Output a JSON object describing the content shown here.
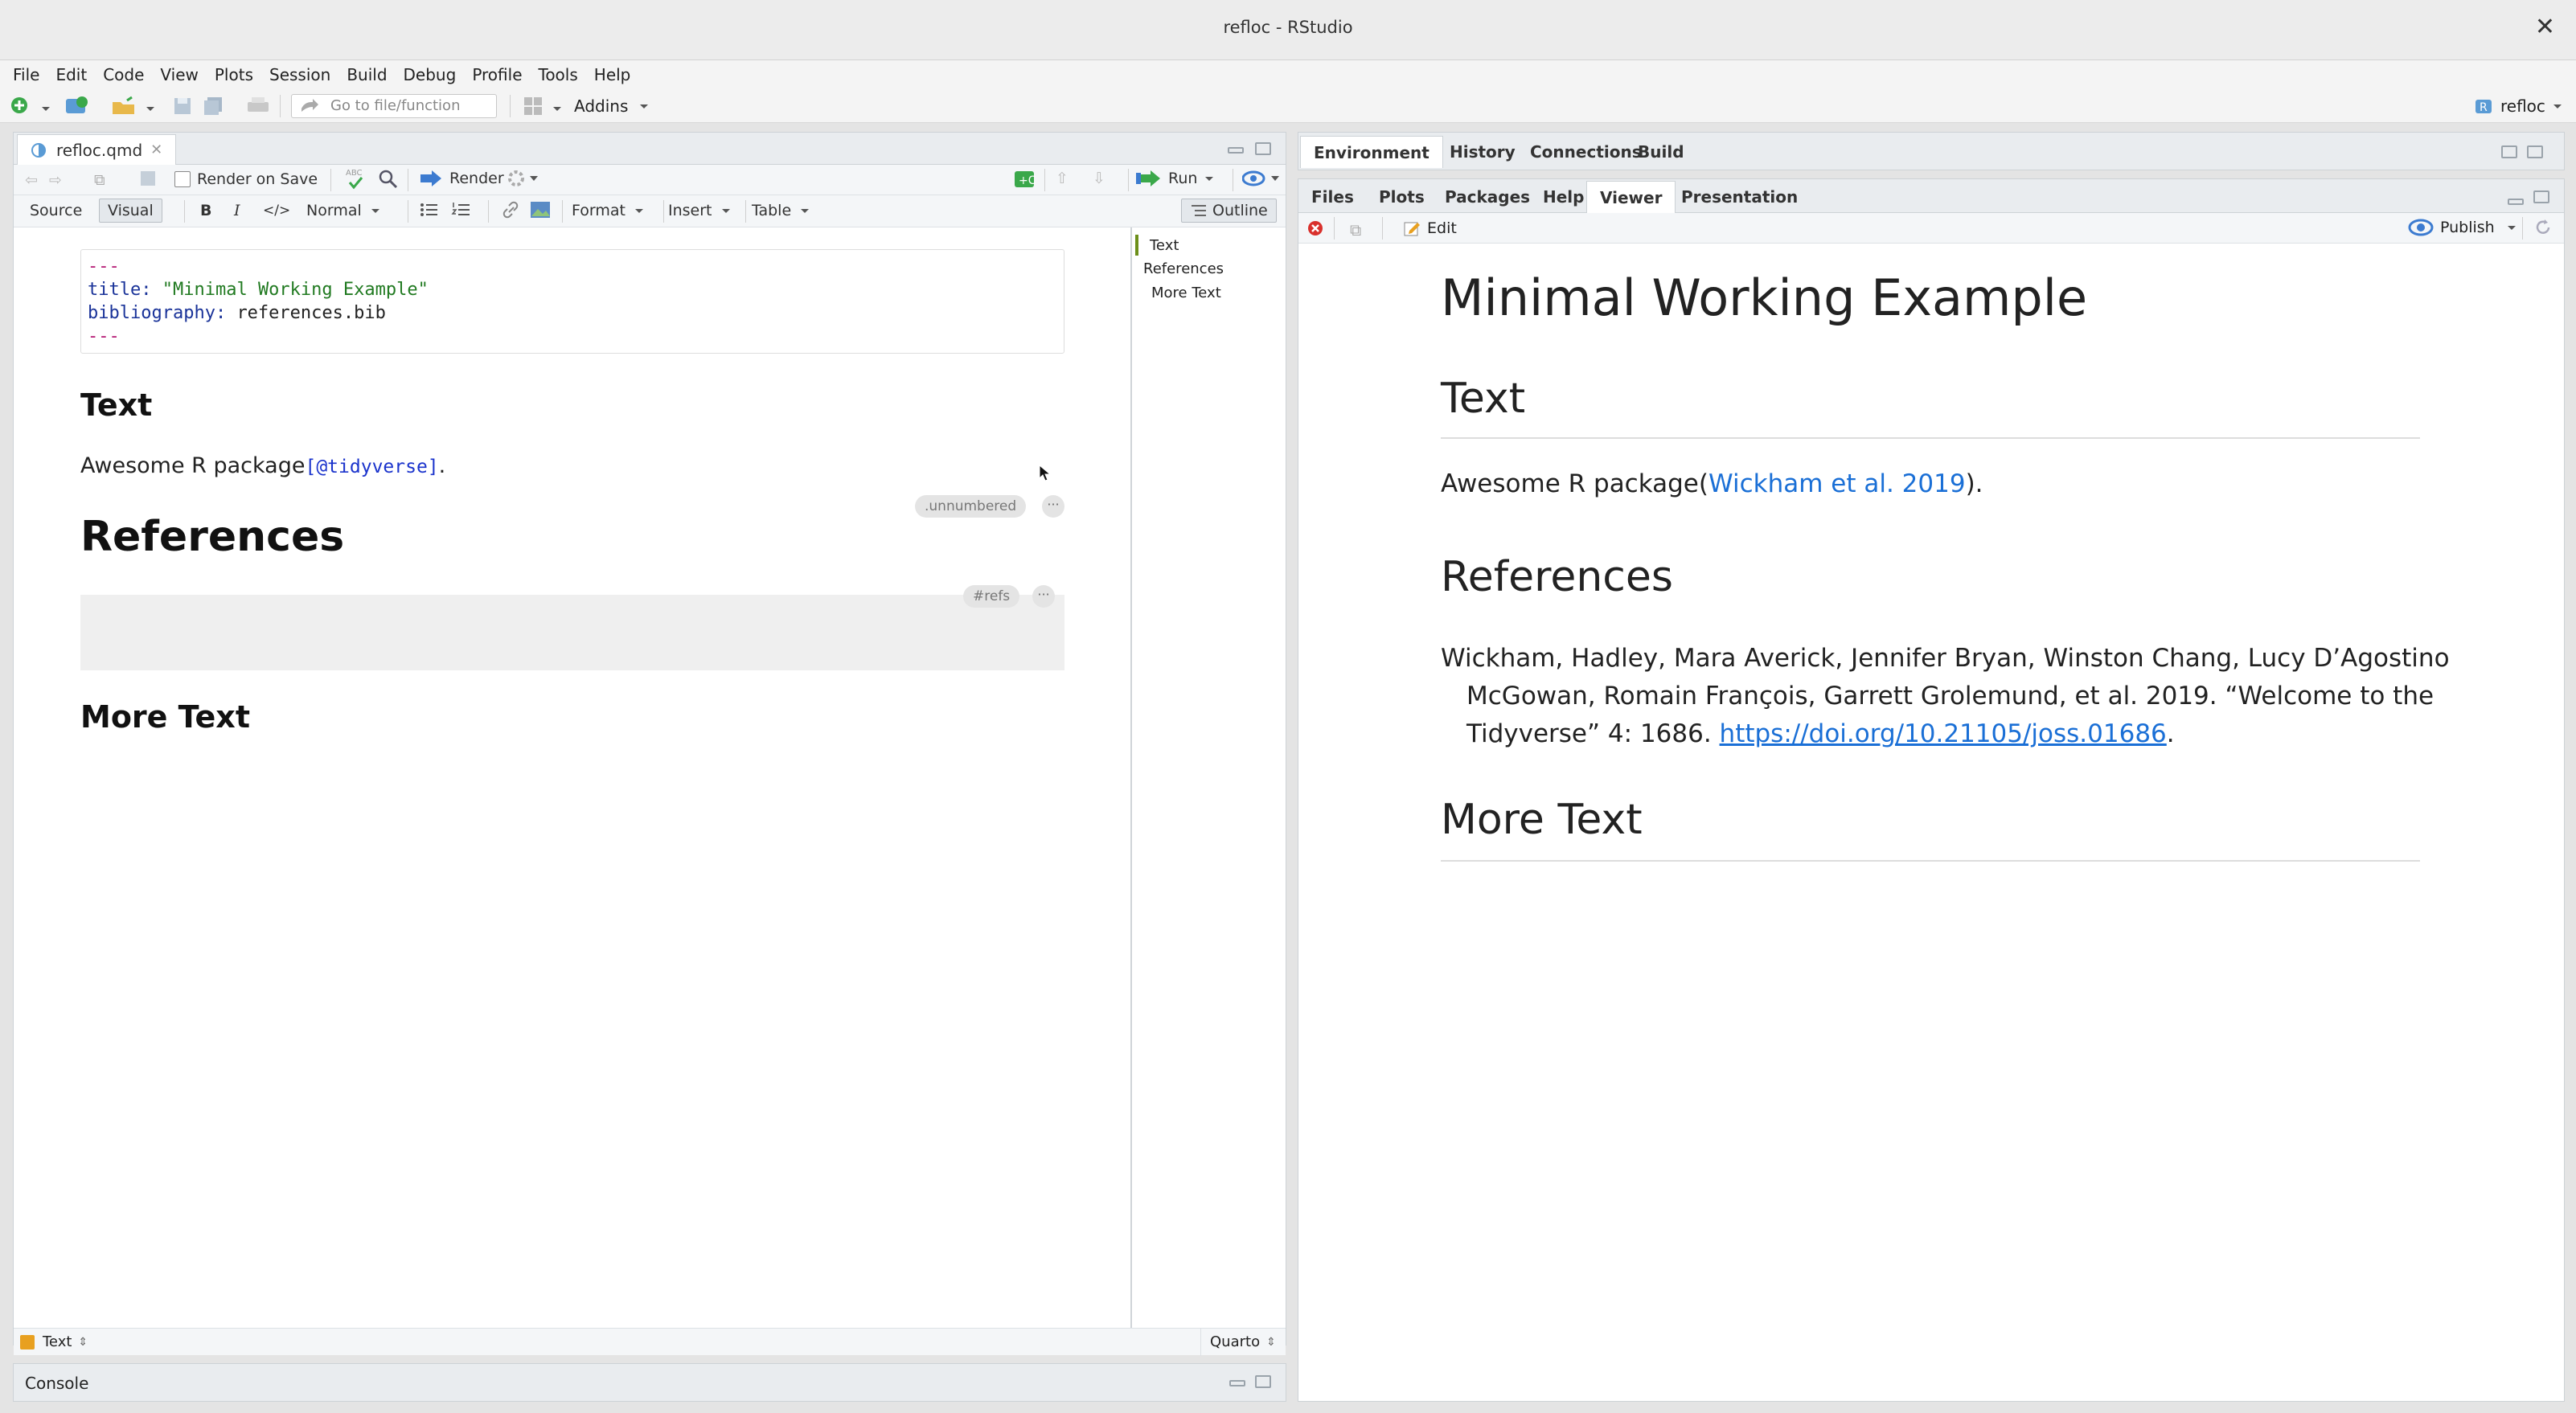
{
  "window": {
    "title": "refloc - RStudio",
    "close": "✕"
  },
  "menu": [
    "File",
    "Edit",
    "Code",
    "View",
    "Plots",
    "Session",
    "Build",
    "Debug",
    "Profile",
    "Tools",
    "Help"
  ],
  "toolbar": {
    "goto_placeholder": "Go to file/function",
    "addins": "Addins",
    "project": "refloc"
  },
  "editor": {
    "filename": "refloc.qmd",
    "render_on_save": "Render on Save",
    "render": "Render",
    "run": "Run",
    "mode_source": "Source",
    "mode_visual": "Visual",
    "bold": "B",
    "italic": "I",
    "code": "</>",
    "block_style": "Normal",
    "format": "Format",
    "insert": "Insert",
    "table": "Table",
    "outline": "Outline",
    "yaml": {
      "dash1": "---",
      "title_key": "title:",
      "title_val": "\"Minimal Working Example\"",
      "bib_key": "bibliography:",
      "bib_val": "references.bib",
      "dash2": "---"
    },
    "h_text": "Text",
    "para_prefix": "Awesome R package",
    "para_cite": "[@tidyverse]",
    "para_suffix": ".",
    "chip_unnumbered": ".unnumbered",
    "h_refs": "References",
    "chip_refs": "#refs",
    "h_more": "More Text",
    "dots": "···",
    "status_left": "Text",
    "status_right": "Quarto"
  },
  "outline": [
    "Text",
    "References",
    "More Text"
  ],
  "console": {
    "label": "Console"
  },
  "top_right_tabs": [
    "Environment",
    "History",
    "Connections",
    "Build"
  ],
  "bottom_right_tabs": [
    "Files",
    "Plots",
    "Packages",
    "Help",
    "Viewer",
    "Presentation"
  ],
  "viewer": {
    "edit": "Edit",
    "publish": "Publish",
    "title": "Minimal Working Example",
    "h_text": "Text",
    "para_prefix": "Awesome R package(",
    "para_link": "Wickham et al. 2019",
    "para_suffix": ").",
    "h_refs": "References",
    "ref_line1": "Wickham, Hadley, Mara Averick, Jennifer Bryan, Winston Chang, Lucy D’Agostino",
    "ref_line2": "McGowan, Romain François, Garrett Grolemund, et al. 2019. “Welcome to the",
    "ref_line3_prefix": "Tidyverse” 4: 1686. ",
    "ref_url": "https://doi.org/10.21105/joss.01686",
    "ref_line3_suffix": ".",
    "h_more": "More Text"
  }
}
